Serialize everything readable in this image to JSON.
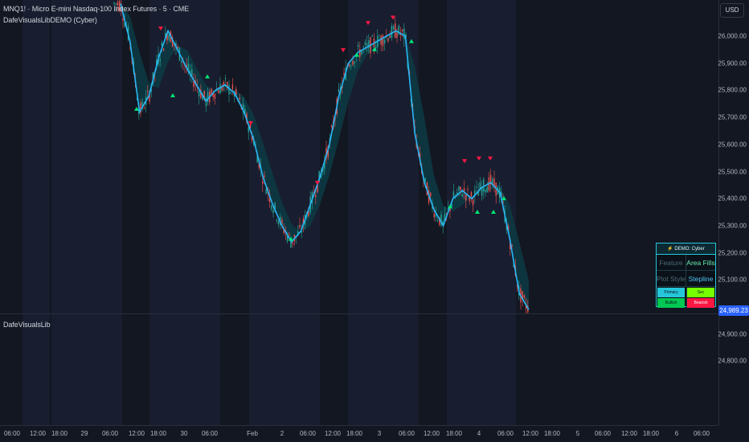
{
  "header": {
    "symbol_line": "MNQ1! · Micro E-mini Nasdaq-100 Index Futures · 5 · CME",
    "indicator_line": "DafeVisualsLibDEMO (Cyber)"
  },
  "sub_pane": {
    "title": "DafeVisualsLib"
  },
  "price_axis": {
    "currency": "USD",
    "ticks": [
      "26,000.00",
      "25,900.00",
      "25,800.00",
      "25,700.00",
      "25,600.00",
      "25,500.00",
      "25,400.00",
      "25,300.00",
      "25,200.00",
      "25,100.00",
      "24,900.00",
      "24,800.00"
    ],
    "last_price": "24,989.23"
  },
  "time_axis": {
    "ticks": [
      "06:00",
      "12:00",
      "18:00",
      "29",
      "06:00",
      "12:00",
      "18:00",
      "30",
      "06:00",
      "Feb",
      "2",
      "06:00",
      "12:00",
      "18:00",
      "3",
      "06:00",
      "12:00",
      "18:00",
      "4",
      "06:00",
      "12:00",
      "18:00",
      "5",
      "06:00",
      "12:00",
      "18:00",
      "6",
      "06:00"
    ]
  },
  "demo_table": {
    "title": "⚡ DEMO: Cyber",
    "rows": [
      {
        "label": "Feature",
        "value": "Area Fills"
      },
      {
        "label": "Plot Style",
        "value": "Stepline"
      }
    ],
    "swatches": [
      "Primary",
      "Sec",
      "Bullish",
      "Bearish"
    ]
  },
  "colors": {
    "background": "#131722",
    "session_shade": "#181e2f",
    "bull_candle": "#26a69a",
    "bear_candle": "#ef5350",
    "ma_line": "#29b6f6",
    "ma_fill": "#0d3b44",
    "bull_signal": "#00e676",
    "bear_signal": "#ff1744",
    "last_price_tag": "#2962ff",
    "table_border": "#26c6da"
  },
  "icons": {
    "bull_marker": "triangle-up-icon",
    "bear_marker": "triangle-down-icon"
  },
  "chart_data": {
    "type": "line",
    "title": "MNQ1! · Micro E-mini Nasdaq-100 Index Futures · 5 · CME",
    "xlabel": "",
    "ylabel": "",
    "ylim": [
      24740,
      26080
    ],
    "x_labels": [
      "06:00",
      "12:00",
      "18:00",
      "29",
      "06:00",
      "12:00",
      "18:00",
      "30",
      "06:00",
      "Feb",
      "2",
      "06:00",
      "12:00",
      "18:00",
      "3",
      "06:00",
      "12:00",
      "18:00",
      "4",
      "06:00",
      "12:00",
      "18:00",
      "5",
      "06:00",
      "12:00",
      "18:00",
      "6",
      "06:00"
    ],
    "series": [
      {
        "values": [
          26120,
          25980,
          25720,
          25780,
          25920,
          26020,
          25950,
          25880,
          25820,
          25760,
          25800,
          25820,
          25790,
          25720,
          25620,
          25480,
          25380,
          25300,
          25240,
          25280,
          25380,
          25480,
          25600,
          25780,
          25900,
          25940,
          25960,
          25980,
          26000,
          26020,
          26000,
          25640,
          25460,
          25360,
          25300,
          25400,
          25430,
          25400,
          25440,
          25460,
          25420,
          25250,
          25050,
          24990
        ]
      }
    ],
    "last_value": 24989.23,
    "grid": false,
    "legend": "none"
  }
}
